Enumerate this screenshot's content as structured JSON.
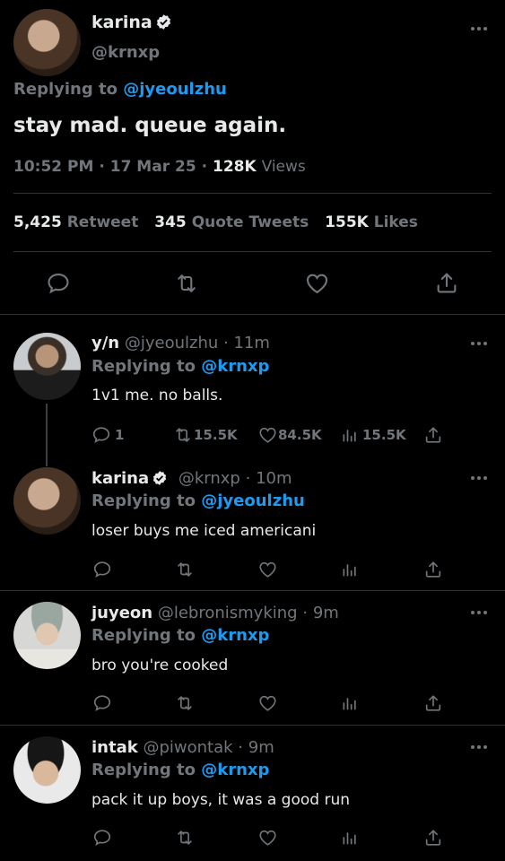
{
  "main_tweet": {
    "author_name": "karina",
    "author_handle": "@krnxp",
    "replying_prefix": "Replying to",
    "replying_to": "@jyeoulzhu",
    "text": "stay mad. queue again.",
    "time": "10:52 PM",
    "date": "17 Mar 25",
    "views_count": "128K",
    "views_label": "Views",
    "retweets_count": "5,425",
    "retweets_label": "Retweet",
    "quotes_count": "345",
    "quotes_label": "Quote Tweets",
    "likes_count": "155K",
    "likes_label": "Likes"
  },
  "replies": [
    {
      "name": "y/n",
      "handle": "@jyeoulzhu",
      "time": "11m",
      "replying_prefix": "Replying to",
      "replying_to": "@krnxp",
      "text": "1v1 me. no balls.",
      "reply_count": "1",
      "retweet_count": "15.5K",
      "like_count": "84.5K",
      "view_count": "15.5K"
    },
    {
      "name": "karina",
      "handle": "@krnxp",
      "time": "10m",
      "replying_prefix": "Replying to",
      "replying_to": "@jyeoulzhu",
      "text": "loser buys me iced americani"
    },
    {
      "name": "juyeon",
      "handle": "@lebronismyking",
      "time": "9m",
      "replying_prefix": "Replying to",
      "replying_to": "@krnxp",
      "text": "bro you're cooked"
    },
    {
      "name": "intak",
      "handle": "@piwontak",
      "time": "9m",
      "replying_prefix": "Replying to",
      "replying_to": "@krnxp",
      "text": "pack it up boys, it was a good run"
    }
  ],
  "separator_dot": "·",
  "icons": [
    "more-icon",
    "verified-icon",
    "reply-icon",
    "retweet-icon",
    "like-icon",
    "views-icon",
    "share-icon"
  ],
  "colors": {
    "background": "#000000",
    "text": "#e7e9ea",
    "muted": "#71767b",
    "accent": "#1d9bf0",
    "divider": "#2f3336"
  }
}
